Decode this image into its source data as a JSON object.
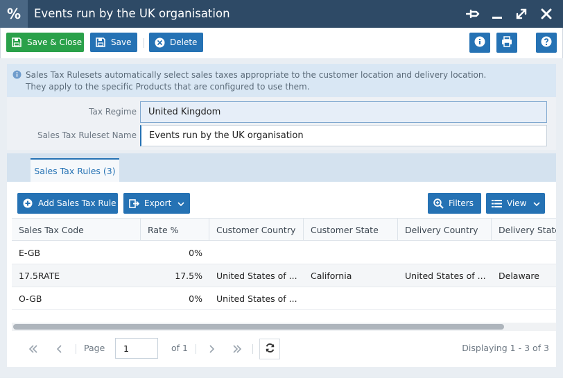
{
  "window": {
    "app_icon": "percent-icon",
    "title": "Events run by the UK organisation",
    "controls": [
      "pin-icon",
      "minimize-icon",
      "maximize-icon",
      "close-icon"
    ]
  },
  "toolbar": {
    "save_close_label": "Save & Close",
    "save_label": "Save",
    "delete_label": "Delete"
  },
  "info": {
    "line1": "Sales Tax Rulesets automatically select sales taxes appropriate to the customer location and delivery location.",
    "line2": "They apply to the specific Products that are configured to use them."
  },
  "form": {
    "tax_regime_label": "Tax Regime",
    "tax_regime_value": "United Kingdom",
    "ruleset_name_label": "Sales Tax Ruleset Name",
    "ruleset_name_value": "Events run by the UK organisation"
  },
  "tabs": {
    "active_label": "Sales Tax Rules (3)"
  },
  "grid_toolbar": {
    "add_label": "Add Sales Tax Rule",
    "export_label": "Export",
    "filters_label": "Filters",
    "view_label": "View"
  },
  "grid": {
    "columns": [
      "Sales Tax Code",
      "Rate %",
      "Customer Country",
      "Customer State",
      "Delivery Country",
      "Delivery State"
    ],
    "rows": [
      [
        "E-GB",
        "0%",
        "",
        "",
        "",
        ""
      ],
      [
        "17.5RATE",
        "17.5%",
        "United States of ...",
        "California",
        "United States of ...",
        "Delaware"
      ],
      [
        "O-GB",
        "0%",
        "United States of ...",
        "",
        "",
        ""
      ]
    ]
  },
  "pager": {
    "page_label": "Page",
    "page_value": "1",
    "of_label": "of 1",
    "displaying": "Displaying 1 - 3 of 3"
  },
  "colors": {
    "titlebar": "#2e4a66",
    "primary": "#2572b4",
    "success": "#2aa14a"
  }
}
